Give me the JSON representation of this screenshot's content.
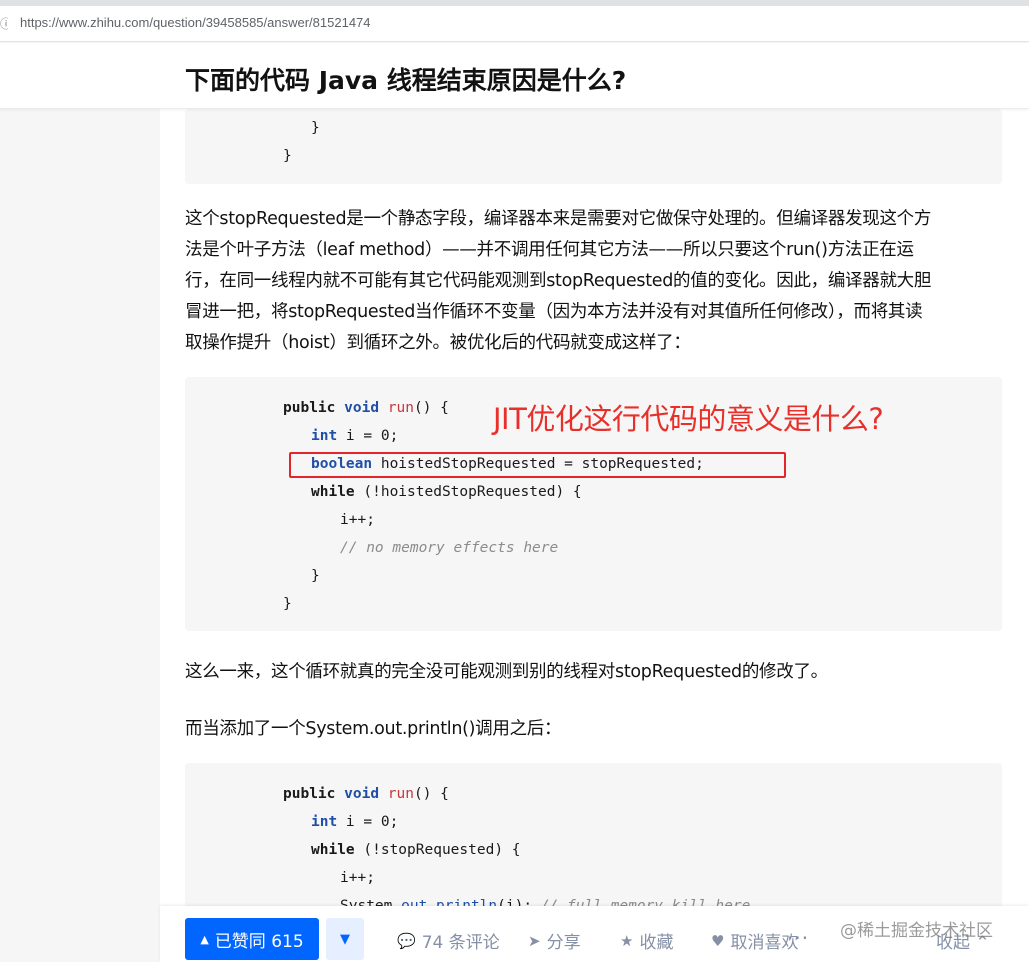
{
  "browser": {
    "url": "https://www.zhihu.com/question/39458585/answer/81521474"
  },
  "question": {
    "title": "下面的代码 Java 线程结束原因是什么?"
  },
  "code1": {
    "line1": "}",
    "line2": "}"
  },
  "paragraphs": {
    "p1_l1": "这个stopRequested是一个静态字段，编译器本来是需要对它做保守处理的。但编译器发现这个方",
    "p1_l2": "法是个叶子方法（leaf method）——并不调用任何其它方法——所以只要这个run()方法正在运",
    "p1_l3": "行，在同一线程内就不可能有其它代码能观测到stopRequested的值的变化。因此，编译器就大胆",
    "p1_l4": "冒进一把，将stopRequested当作循环不变量（因为本方法并没有对其值所任何修改），而将其读",
    "p1_l5": "取操作提升（hoist）到循环之外。被优化后的代码就变成这样了：",
    "p2": "这么一来，这个循环就真的完全没可能观测到别的线程对stopRequested的修改了。",
    "p3": "而当添加了一个System.out.println()调用之后："
  },
  "code2": {
    "l1_public": "public",
    "l1_void": "void",
    "l1_run": "run",
    "l1_rest": "() {",
    "l2_int": "int",
    "l2_rest": " i = 0;",
    "l3_boolean": "boolean",
    "l3_rest": " hoistedStopRequested = stopRequested;",
    "l4_while": "while",
    "l4_rest": " (!hoistedStopRequested) {",
    "l5": "i++;",
    "l6": "// no memory effects here",
    "l7": "}",
    "l8": "}"
  },
  "annotation": {
    "text": "JIT优化这行代码的意义是什么?"
  },
  "code3": {
    "l1_public": "public",
    "l1_void": "void",
    "l1_run": "run",
    "l1_rest": "() {",
    "l2_int": "int",
    "l2_rest": " i = 0;",
    "l3_while": "while",
    "l3_rest": " (!stopRequested) {",
    "l4": "i++;",
    "l5_pre": "System.",
    "l5_out": "out",
    "l5_dot": ".",
    "l5_println": "println",
    "l5_args": "(i); ",
    "l5_comment": "// full memory kill here"
  },
  "actions": {
    "upvote": "已赞同 615",
    "upvote_icon": "▲",
    "downvote_icon": "▼",
    "comments": "74 条评论",
    "share": "分享",
    "favorite": "收藏",
    "unlike": "取消喜欢",
    "more": "···",
    "collapse": "收起",
    "collapse_icon": "⌃"
  },
  "watermark": "@稀土掘金技术社区",
  "colors": {
    "accent": "#0066ff",
    "annotation": "#e8302b",
    "keyword_type": "#1f4fa7",
    "function": "#c7363b"
  }
}
